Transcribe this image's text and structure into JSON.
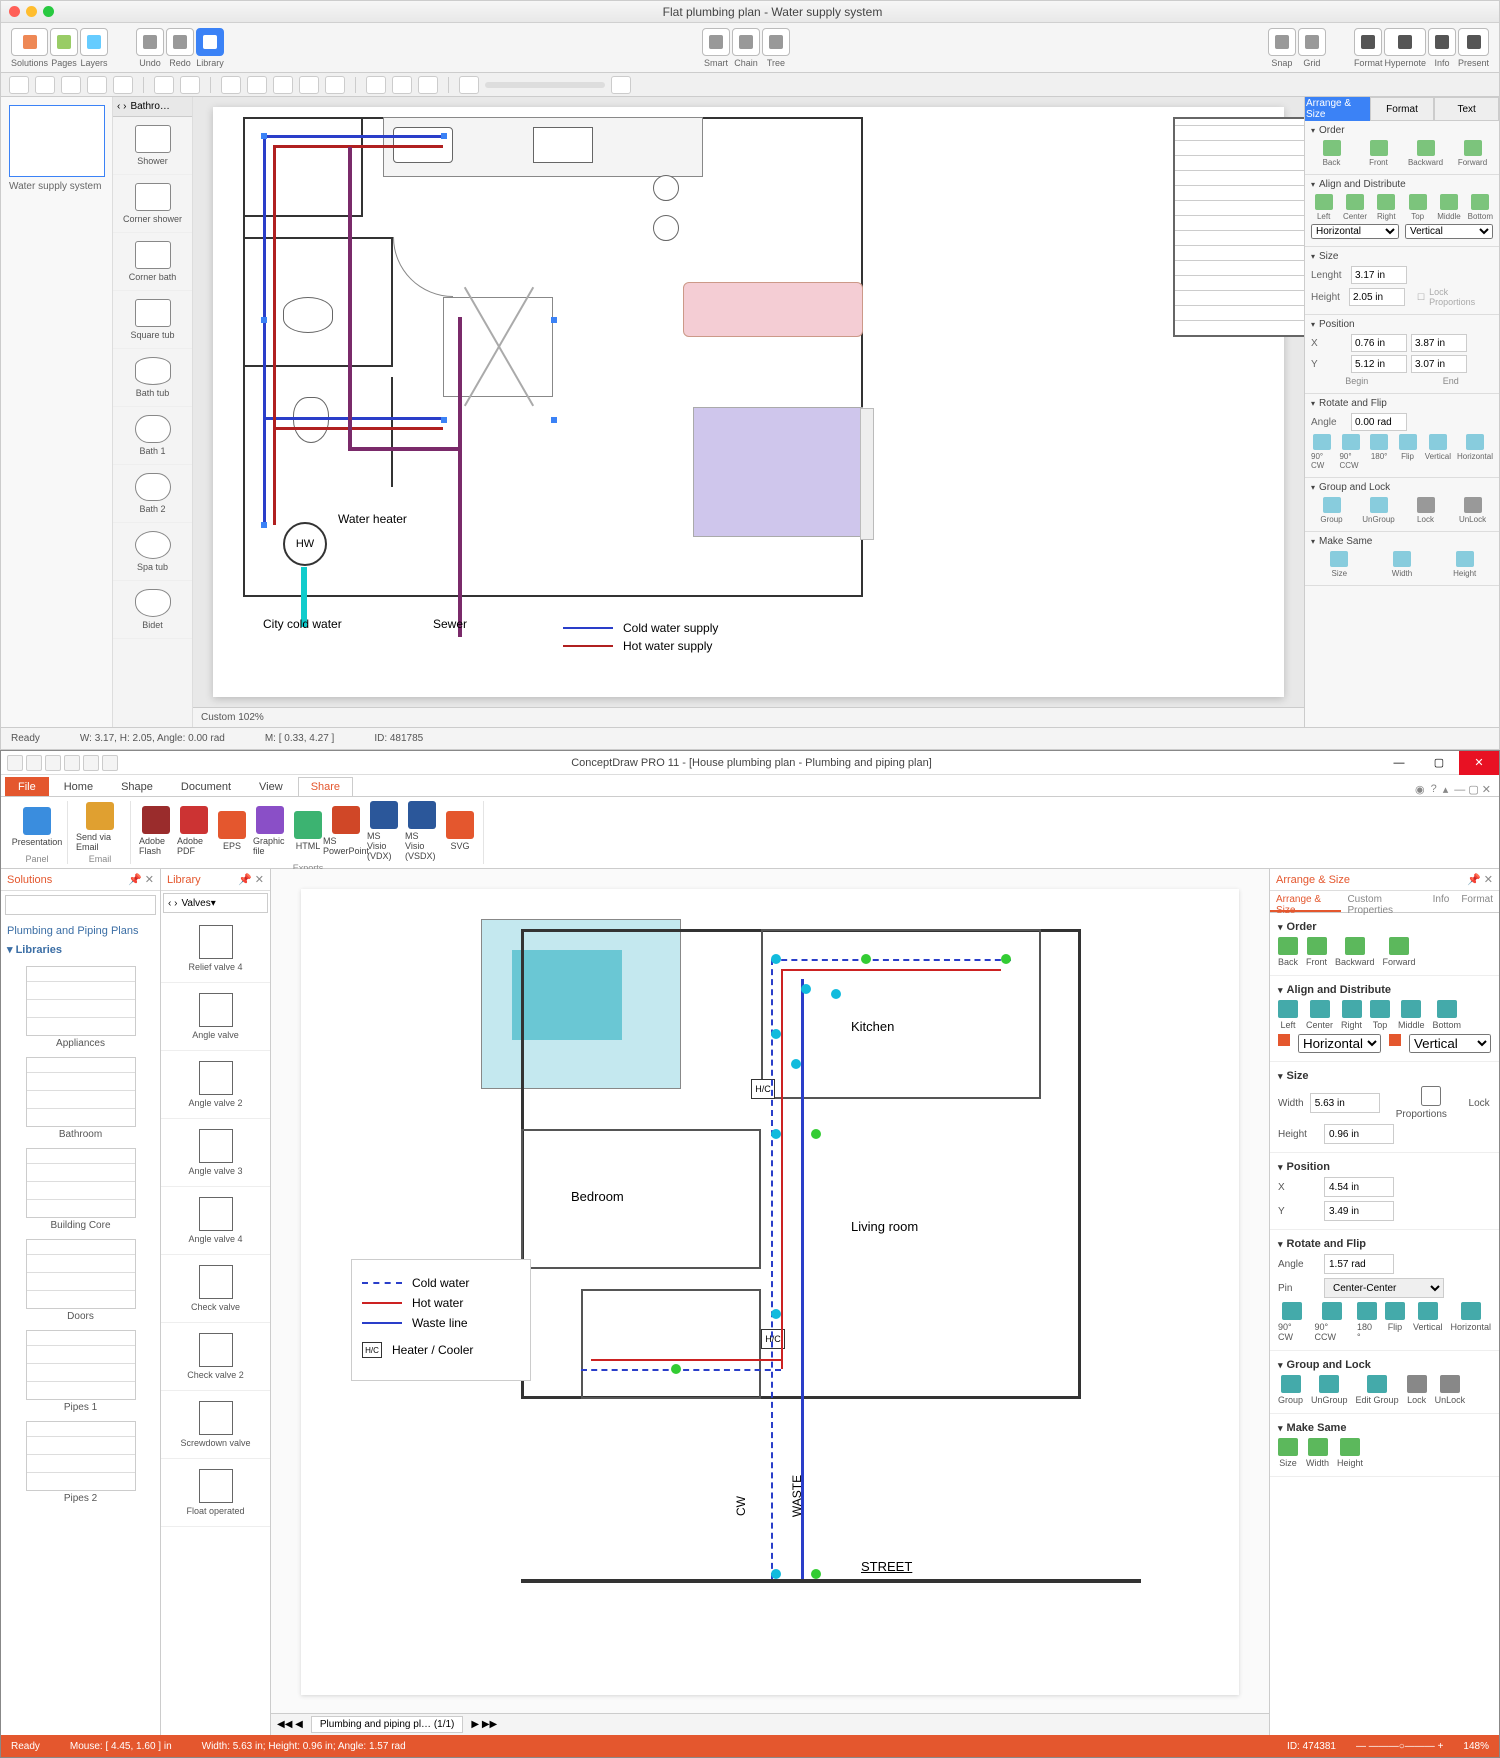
{
  "mac": {
    "title": "Flat plumbing plan - Water supply system",
    "toolbar": {
      "solutions": "Solutions",
      "pages": "Pages",
      "layers": "Layers",
      "undo": "Undo",
      "redo": "Redo",
      "library": "Library",
      "smart": "Smart",
      "chain": "Chain",
      "tree": "Tree",
      "snap": "Snap",
      "grid": "Grid",
      "format": "Format",
      "hypernote": "Hypernote",
      "info": "Info",
      "present": "Present"
    },
    "thumb_label": "Water supply system",
    "stencil_header": "Bathro…",
    "stencils": [
      "Shower",
      "Corner shower",
      "Corner bath",
      "Square tub",
      "Bath tub",
      "Bath 1",
      "Bath 2",
      "Spa tub",
      "Bidet"
    ],
    "zoom": "Custom 102%",
    "status": {
      "ready": "Ready",
      "wh": "W: 3.17,  H: 2.05,  Angle: 0.00 rad",
      "mouse": "M: [ 0.33, 4.27 ]",
      "id": "ID: 481785"
    },
    "panel": {
      "tabs": {
        "arrange": "Arrange & Size",
        "format": "Format",
        "text": "Text"
      },
      "order": {
        "header": "Order",
        "back": "Back",
        "front": "Front",
        "backward": "Backward",
        "forward": "Forward"
      },
      "align": {
        "header": "Align and Distribute",
        "left": "Left",
        "center": "Center",
        "right": "Right",
        "top": "Top",
        "middle": "Middle",
        "bottom": "Bottom",
        "horiz": "Horizontal",
        "vert": "Vertical"
      },
      "size": {
        "header": "Size",
        "length_lbl": "Lenght",
        "length": "3.17 in",
        "height_lbl": "Height",
        "height": "2.05 in",
        "lock": "Lock Proportions"
      },
      "position": {
        "header": "Position",
        "x_lbl": "X",
        "x": "0.76 in",
        "x2": "3.87 in",
        "y_lbl": "Y",
        "y": "5.12 in",
        "y2": "3.07 in",
        "begin": "Begin",
        "end": "End"
      },
      "rotate": {
        "header": "Rotate and Flip",
        "angle_lbl": "Angle",
        "angle": "0.00 rad",
        "cw": "90° CW",
        "ccw": "90° CCW",
        "r180": "180°",
        "flip": "Flip",
        "vert": "Vertical",
        "horiz": "Horizontal"
      },
      "group": {
        "header": "Group and Lock",
        "group": "Group",
        "ungroup": "UnGroup",
        "lock": "Lock",
        "unlock": "UnLock"
      },
      "makesame": {
        "header": "Make Same",
        "size": "Size",
        "width": "Width",
        "height": "Height"
      }
    },
    "floorplan": {
      "hw": "HW",
      "water_heater": "Water heater",
      "city_cold": "City cold water",
      "sewer": "Sewer",
      "legend_cold": "Cold water supply",
      "legend_hot": "Hot water supply"
    }
  },
  "win": {
    "title": "ConceptDraw PRO 11 - [House plumbing plan - Plumbing and piping plan]",
    "ribbon_tabs": {
      "file": "File",
      "home": "Home",
      "shape": "Shape",
      "document": "Document",
      "view": "View",
      "share": "Share"
    },
    "ribbon": {
      "presentation": "Presentation",
      "send_email": "Send via Email",
      "adobe_flash": "Adobe Flash",
      "adobe_pdf": "Adobe PDF",
      "eps": "EPS",
      "graphic_file": "Graphic file",
      "html": "HTML",
      "ms_ppt": "MS PowerPoint",
      "visio_vdx": "MS Visio (VDX)",
      "visio_vsdx": "MS Visio (VSDX)",
      "svg": "SVG",
      "grp_panel": "Panel",
      "grp_email": "Email",
      "grp_exports": "Exports"
    },
    "solutions": {
      "header": "Solutions",
      "tree_root": "Plumbing and Piping Plans",
      "libraries_lbl": "Libraries",
      "libs": [
        "Appliances",
        "Bathroom",
        "Building Core",
        "Doors",
        "Pipes 1",
        "Pipes 2"
      ]
    },
    "library": {
      "header": "Library",
      "filter": "Valves",
      "items": [
        "Relief valve 4",
        "Angle valve",
        "Angle valve 2",
        "Angle valve 3",
        "Angle valve 4",
        "Check valve",
        "Check valve 2",
        "Screwdown valve",
        "Float operated"
      ]
    },
    "canvas": {
      "tab": "Plumbing and piping pl… (1/1)"
    },
    "floorplan": {
      "kitchen": "Kitchen",
      "bedroom": "Bedroom",
      "living": "Living room",
      "hc": "H/C",
      "cw": "CW",
      "waste": "WASTE",
      "street": "STREET",
      "legend": {
        "cold": "Cold water",
        "hot": "Hot water",
        "waste": "Waste line",
        "hc": "Heater / Cooler"
      }
    },
    "panel": {
      "header": "Arrange & Size",
      "tabs": {
        "arrange": "Arrange & Size",
        "custom": "Custom Properties",
        "info": "Info",
        "format": "Format"
      },
      "order": {
        "header": "Order",
        "back": "Back",
        "front": "Front",
        "backward": "Backward",
        "forward": "Forward"
      },
      "align": {
        "header": "Align and Distribute",
        "left": "Left",
        "center": "Center",
        "right": "Right",
        "top": "Top",
        "middle": "Middle",
        "bottom": "Bottom",
        "horiz": "Horizontal",
        "vert": "Vertical"
      },
      "size": {
        "header": "Size",
        "width_lbl": "Width",
        "width": "5.63 in",
        "height_lbl": "Height",
        "height": "0.96 in",
        "lock": "Lock Proportions"
      },
      "position": {
        "header": "Position",
        "x_lbl": "X",
        "x": "4.54 in",
        "y_lbl": "Y",
        "y": "3.49 in"
      },
      "rotate": {
        "header": "Rotate and Flip",
        "angle_lbl": "Angle",
        "angle": "1.57 rad",
        "pin_lbl": "Pin",
        "pin": "Center-Center",
        "cw": "90° CW",
        "ccw": "90° CCW",
        "r180": "180 °",
        "flip": "Flip",
        "vert": "Vertical",
        "horiz": "Horizontal"
      },
      "group": {
        "header": "Group and Lock",
        "group": "Group",
        "ungroup": "UnGroup",
        "edit": "Edit Group",
        "lock": "Lock",
        "unlock": "UnLock"
      },
      "makesame": {
        "header": "Make Same",
        "size": "Size",
        "width": "Width",
        "height": "Height"
      }
    },
    "status": {
      "ready": "Ready",
      "mouse": "Mouse: [ 4.45, 1.60 ] in",
      "size": "Width: 5.63 in;  Height: 0.96 in;  Angle: 1.57 rad",
      "id": "ID: 474381",
      "zoom": "148%"
    }
  }
}
